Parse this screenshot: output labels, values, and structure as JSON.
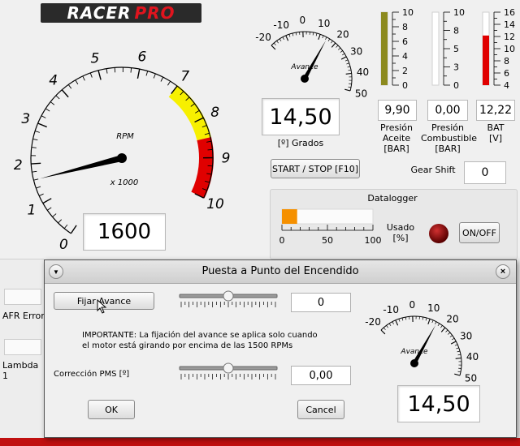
{
  "logo": {
    "text_a": "RACER",
    "text_b": "PRO"
  },
  "rpm_gauge": {
    "title": "RPM",
    "multiplier": "x 1000",
    "ticks": [
      "0",
      "1",
      "2",
      "3",
      "4",
      "5",
      "6",
      "7",
      "8",
      "9",
      "10"
    ],
    "needle_value": 1.6,
    "readout": "1600",
    "colors": {
      "yellow": "#f7f000",
      "red": "#e00000"
    }
  },
  "advance_gauge": {
    "title": "Avance",
    "ticks": [
      "-20",
      "-10",
      "0",
      "10",
      "20",
      "30",
      "40",
      "50"
    ],
    "needle_value": 14.5,
    "readout": "14,50",
    "unit_label": "[º] Grados"
  },
  "bars": [
    {
      "ticks": [
        "10",
        "8",
        "6",
        "4",
        "2",
        "0"
      ],
      "fill_fraction": 1.0,
      "color": "#8c8a1e",
      "value": "9,90",
      "label": "Presión\nAceite\n[BAR]"
    },
    {
      "ticks": [
        "10",
        "8",
        "5",
        "3",
        "0"
      ],
      "fill_fraction": 0.0,
      "color": "#c00000",
      "value": "0,00",
      "label": "Presión\nCombustible\n[BAR]"
    },
    {
      "ticks": [
        "16",
        "14",
        "12",
        "10",
        "8",
        "6",
        "4"
      ],
      "fill_fraction": 0.68,
      "color": "#e00000",
      "value": "12,22",
      "label": "BAT\n[V]"
    }
  ],
  "start_stop_button": "START / STOP [F10]",
  "gear_shift": {
    "label": "Gear Shift",
    "value": "0"
  },
  "datalogger": {
    "title": "Datalogger",
    "ticks": [
      "0",
      "50",
      "100"
    ],
    "fill_fraction": 0.06,
    "used_label": "Usado\n[%]",
    "onoff_button": "ON/OFF"
  },
  "background_labels": {
    "afr_error": "AFR Error",
    "lambda": "Lambda 1"
  },
  "dialog": {
    "title": "Puesta a Punto del Encendido",
    "fijar_button": "Fijar Avance",
    "slider1_value": "0",
    "important_line1": "IMPORTANTE: La fijación del avance se aplica solo cuando",
    "important_line2": "el motor está girando por encima de las 1500 RPMs",
    "pms_label": "Corrección PMS  [º]",
    "slider2_value": "0,00",
    "ok_button": "OK",
    "cancel_button": "Cancel",
    "mini_gauge": {
      "title": "Avance",
      "ticks": [
        "-20",
        "-10",
        "0",
        "10",
        "20",
        "30",
        "40",
        "50"
      ],
      "needle_value": 14.5,
      "readout": "14,50"
    }
  }
}
